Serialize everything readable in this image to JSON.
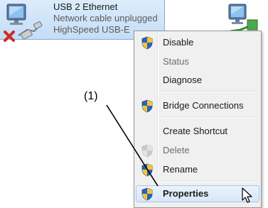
{
  "adapter": {
    "name": "USB 2 Ethernet",
    "status": "Network cable unplugged",
    "device": "HighSpeed USB-E",
    "icon": "network-adapter-icon",
    "status_icon": "red-x-disconnected-icon",
    "cable_icon": "ethernet-cable-icon"
  },
  "adapter2": {
    "icon": "network-adapter-icon"
  },
  "menu": {
    "items": [
      {
        "label": "Disable",
        "icon": "uac-shield-icon",
        "enabled": true
      },
      {
        "label": "Status",
        "enabled": false
      },
      {
        "label": "Diagnose",
        "enabled": true
      },
      {
        "label": "Bridge Connections",
        "icon": "uac-shield-icon",
        "enabled": true
      },
      {
        "label": "Create Shortcut",
        "enabled": true
      },
      {
        "label": "Delete",
        "icon": "uac-shield-icon",
        "enabled": false
      },
      {
        "label": "Rename",
        "icon": "uac-shield-icon",
        "enabled": true
      },
      {
        "label": "Properties",
        "icon": "uac-shield-icon",
        "enabled": true,
        "bold": true,
        "highlighted": true
      }
    ]
  },
  "annotation": {
    "label": "(1)"
  },
  "colors": {
    "selection": "#c4ddf6",
    "menu_background": "#f0f0f0",
    "disabled_text": "#6d6d6d",
    "shield_blue": "#2a62c9",
    "shield_yellow": "#f3c62a"
  }
}
